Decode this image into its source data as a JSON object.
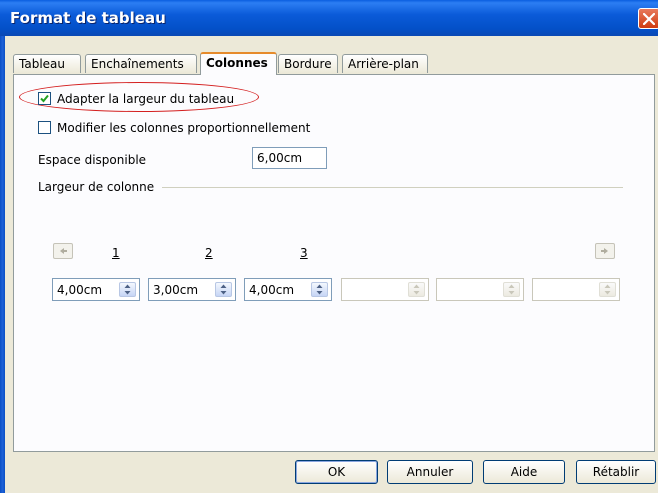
{
  "window": {
    "title": "Format de tableau"
  },
  "tabs": [
    {
      "label": "Tableau",
      "active": false
    },
    {
      "label": "Enchaînements",
      "active": false
    },
    {
      "label": "Colonnes",
      "active": true
    },
    {
      "label": "Bordure",
      "active": false
    },
    {
      "label": "Arrière-plan",
      "active": false
    }
  ],
  "options": {
    "adapt_width": {
      "label": "Adapter la largeur du tableau",
      "checked": true
    },
    "proportional": {
      "label": "Modifier les colonnes proportionnellement",
      "checked": false
    }
  },
  "available_space": {
    "label": "Espace disponible",
    "value": "6,00cm"
  },
  "column_width": {
    "group_label": "Largeur de colonne",
    "column_numbers": [
      "1",
      "2",
      "3"
    ],
    "fields": [
      {
        "value": "4,00cm",
        "enabled": true
      },
      {
        "value": "3,00cm",
        "enabled": true
      },
      {
        "value": "4,00cm",
        "enabled": true
      },
      {
        "value": "",
        "enabled": false
      },
      {
        "value": "",
        "enabled": false
      },
      {
        "value": "",
        "enabled": false
      }
    ]
  },
  "buttons": {
    "ok": "OK",
    "cancel": "Annuler",
    "help": "Aide",
    "reset": "Rétablir"
  },
  "colors": {
    "title_bar": "#0350c8",
    "dialog_bg": "#ece9d8",
    "highlight_oval": "#d42020",
    "active_tab_accent": "#e68b2c"
  },
  "icons": {
    "close": "close-icon",
    "check": "checkmark-icon",
    "spin": "spin-up-down-icon",
    "left": "arrow-left-icon",
    "right": "arrow-right-icon"
  }
}
